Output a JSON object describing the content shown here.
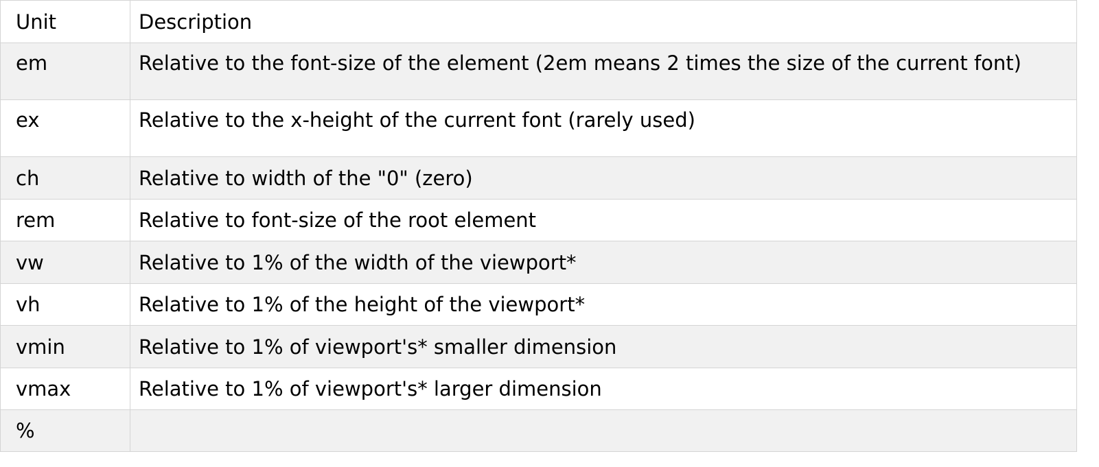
{
  "table": {
    "headers": [
      "Unit",
      "Description"
    ],
    "rows": [
      {
        "unit": "em",
        "description": "Relative to the font-size of the element (2em means 2 times the size of the current font)"
      },
      {
        "unit": "ex",
        "description": "Relative to the x-height of the current font (rarely used)"
      },
      {
        "unit": "ch",
        "description": "Relative to width of the \"0\" (zero)"
      },
      {
        "unit": "rem",
        "description": "Relative to font-size of the root element"
      },
      {
        "unit": "vw",
        "description": "Relative to 1% of the width of the viewport*"
      },
      {
        "unit": "vh",
        "description": "Relative to 1% of the height of the viewport*"
      },
      {
        "unit": "vmin",
        "description": "Relative to 1% of viewport's* smaller dimension"
      },
      {
        "unit": "vmax",
        "description": "Relative to 1% of viewport's* larger dimension"
      },
      {
        "unit": "%",
        "description": ""
      }
    ]
  }
}
